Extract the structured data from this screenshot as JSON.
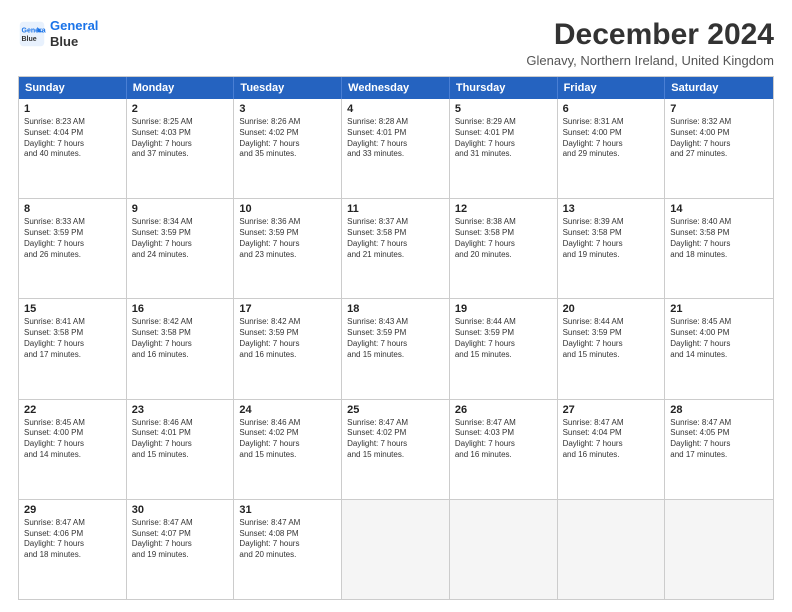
{
  "header": {
    "logo_line1": "General",
    "logo_line2": "Blue",
    "main_title": "December 2024",
    "subtitle": "Glenavy, Northern Ireland, United Kingdom"
  },
  "calendar": {
    "weekdays": [
      "Sunday",
      "Monday",
      "Tuesday",
      "Wednesday",
      "Thursday",
      "Friday",
      "Saturday"
    ],
    "rows": [
      [
        {
          "day": "1",
          "lines": [
            "Sunrise: 8:23 AM",
            "Sunset: 4:04 PM",
            "Daylight: 7 hours",
            "and 40 minutes."
          ]
        },
        {
          "day": "2",
          "lines": [
            "Sunrise: 8:25 AM",
            "Sunset: 4:03 PM",
            "Daylight: 7 hours",
            "and 37 minutes."
          ]
        },
        {
          "day": "3",
          "lines": [
            "Sunrise: 8:26 AM",
            "Sunset: 4:02 PM",
            "Daylight: 7 hours",
            "and 35 minutes."
          ]
        },
        {
          "day": "4",
          "lines": [
            "Sunrise: 8:28 AM",
            "Sunset: 4:01 PM",
            "Daylight: 7 hours",
            "and 33 minutes."
          ]
        },
        {
          "day": "5",
          "lines": [
            "Sunrise: 8:29 AM",
            "Sunset: 4:01 PM",
            "Daylight: 7 hours",
            "and 31 minutes."
          ]
        },
        {
          "day": "6",
          "lines": [
            "Sunrise: 8:31 AM",
            "Sunset: 4:00 PM",
            "Daylight: 7 hours",
            "and 29 minutes."
          ]
        },
        {
          "day": "7",
          "lines": [
            "Sunrise: 8:32 AM",
            "Sunset: 4:00 PM",
            "Daylight: 7 hours",
            "and 27 minutes."
          ]
        }
      ],
      [
        {
          "day": "8",
          "lines": [
            "Sunrise: 8:33 AM",
            "Sunset: 3:59 PM",
            "Daylight: 7 hours",
            "and 26 minutes."
          ]
        },
        {
          "day": "9",
          "lines": [
            "Sunrise: 8:34 AM",
            "Sunset: 3:59 PM",
            "Daylight: 7 hours",
            "and 24 minutes."
          ]
        },
        {
          "day": "10",
          "lines": [
            "Sunrise: 8:36 AM",
            "Sunset: 3:59 PM",
            "Daylight: 7 hours",
            "and 23 minutes."
          ]
        },
        {
          "day": "11",
          "lines": [
            "Sunrise: 8:37 AM",
            "Sunset: 3:58 PM",
            "Daylight: 7 hours",
            "and 21 minutes."
          ]
        },
        {
          "day": "12",
          "lines": [
            "Sunrise: 8:38 AM",
            "Sunset: 3:58 PM",
            "Daylight: 7 hours",
            "and 20 minutes."
          ]
        },
        {
          "day": "13",
          "lines": [
            "Sunrise: 8:39 AM",
            "Sunset: 3:58 PM",
            "Daylight: 7 hours",
            "and 19 minutes."
          ]
        },
        {
          "day": "14",
          "lines": [
            "Sunrise: 8:40 AM",
            "Sunset: 3:58 PM",
            "Daylight: 7 hours",
            "and 18 minutes."
          ]
        }
      ],
      [
        {
          "day": "15",
          "lines": [
            "Sunrise: 8:41 AM",
            "Sunset: 3:58 PM",
            "Daylight: 7 hours",
            "and 17 minutes."
          ]
        },
        {
          "day": "16",
          "lines": [
            "Sunrise: 8:42 AM",
            "Sunset: 3:58 PM",
            "Daylight: 7 hours",
            "and 16 minutes."
          ]
        },
        {
          "day": "17",
          "lines": [
            "Sunrise: 8:42 AM",
            "Sunset: 3:59 PM",
            "Daylight: 7 hours",
            "and 16 minutes."
          ]
        },
        {
          "day": "18",
          "lines": [
            "Sunrise: 8:43 AM",
            "Sunset: 3:59 PM",
            "Daylight: 7 hours",
            "and 15 minutes."
          ]
        },
        {
          "day": "19",
          "lines": [
            "Sunrise: 8:44 AM",
            "Sunset: 3:59 PM",
            "Daylight: 7 hours",
            "and 15 minutes."
          ]
        },
        {
          "day": "20",
          "lines": [
            "Sunrise: 8:44 AM",
            "Sunset: 3:59 PM",
            "Daylight: 7 hours",
            "and 15 minutes."
          ]
        },
        {
          "day": "21",
          "lines": [
            "Sunrise: 8:45 AM",
            "Sunset: 4:00 PM",
            "Daylight: 7 hours",
            "and 14 minutes."
          ]
        }
      ],
      [
        {
          "day": "22",
          "lines": [
            "Sunrise: 8:45 AM",
            "Sunset: 4:00 PM",
            "Daylight: 7 hours",
            "and 14 minutes."
          ]
        },
        {
          "day": "23",
          "lines": [
            "Sunrise: 8:46 AM",
            "Sunset: 4:01 PM",
            "Daylight: 7 hours",
            "and 15 minutes."
          ]
        },
        {
          "day": "24",
          "lines": [
            "Sunrise: 8:46 AM",
            "Sunset: 4:02 PM",
            "Daylight: 7 hours",
            "and 15 minutes."
          ]
        },
        {
          "day": "25",
          "lines": [
            "Sunrise: 8:47 AM",
            "Sunset: 4:02 PM",
            "Daylight: 7 hours",
            "and 15 minutes."
          ]
        },
        {
          "day": "26",
          "lines": [
            "Sunrise: 8:47 AM",
            "Sunset: 4:03 PM",
            "Daylight: 7 hours",
            "and 16 minutes."
          ]
        },
        {
          "day": "27",
          "lines": [
            "Sunrise: 8:47 AM",
            "Sunset: 4:04 PM",
            "Daylight: 7 hours",
            "and 16 minutes."
          ]
        },
        {
          "day": "28",
          "lines": [
            "Sunrise: 8:47 AM",
            "Sunset: 4:05 PM",
            "Daylight: 7 hours",
            "and 17 minutes."
          ]
        }
      ],
      [
        {
          "day": "29",
          "lines": [
            "Sunrise: 8:47 AM",
            "Sunset: 4:06 PM",
            "Daylight: 7 hours",
            "and 18 minutes."
          ]
        },
        {
          "day": "30",
          "lines": [
            "Sunrise: 8:47 AM",
            "Sunset: 4:07 PM",
            "Daylight: 7 hours",
            "and 19 minutes."
          ]
        },
        {
          "day": "31",
          "lines": [
            "Sunrise: 8:47 AM",
            "Sunset: 4:08 PM",
            "Daylight: 7 hours",
            "and 20 minutes."
          ]
        },
        {
          "day": "",
          "lines": []
        },
        {
          "day": "",
          "lines": []
        },
        {
          "day": "",
          "lines": []
        },
        {
          "day": "",
          "lines": []
        }
      ]
    ]
  }
}
